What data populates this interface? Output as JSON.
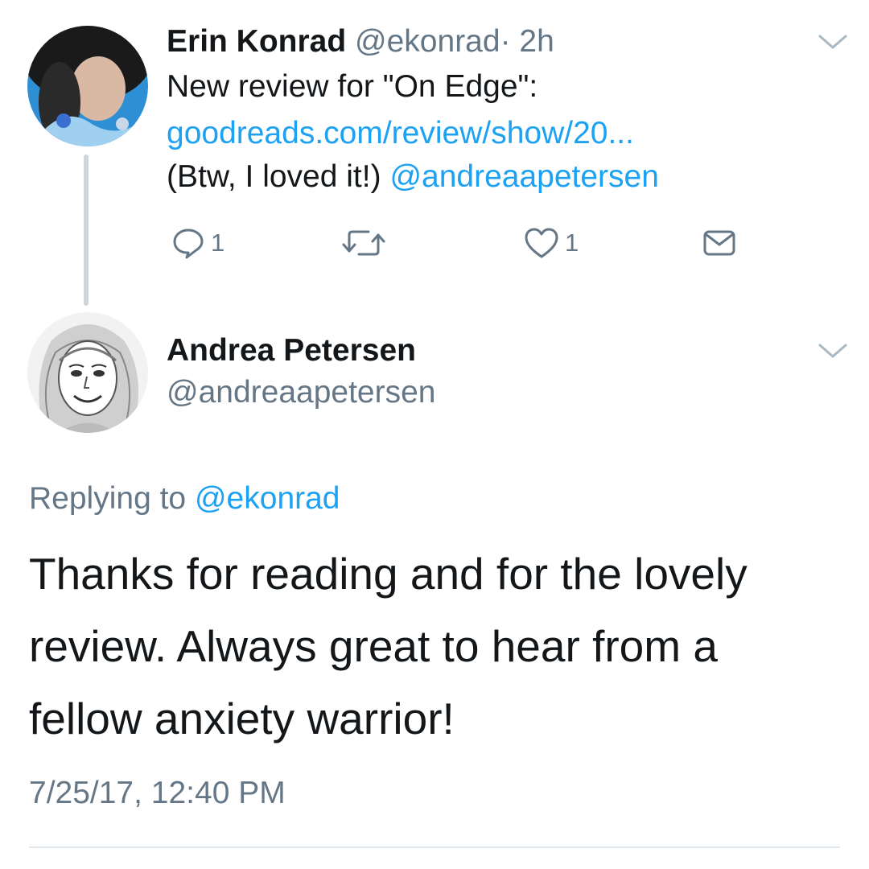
{
  "parent_tweet": {
    "author_name": "Erin Konrad",
    "author_handle": "@ekonrad",
    "separator": "·",
    "time": "2h",
    "text_line1": "New review for \"On Edge\":",
    "link": "goodreads.com/review/show/20...",
    "text_line3": "(Btw, I loved it!)",
    "mention": "@andreaapetersen",
    "actions": {
      "reply_count": "1",
      "retweet_count": "",
      "like_count": "1"
    },
    "icons": [
      "reply-icon",
      "retweet-icon",
      "like-icon",
      "message-icon",
      "chevron-down-icon"
    ]
  },
  "reply_tweet": {
    "author_name": "Andrea Petersen",
    "author_handle": "@andreaapetersen",
    "replying_prefix": "Replying to",
    "replying_handle": "@ekonrad",
    "text": "Thanks for reading and for the lovely review. Always great to hear from a fellow anxiety warrior!",
    "timestamp": "7/25/17, 12:40 PM"
  },
  "colors": {
    "link": "#1da1f2",
    "secondary_text": "#657786",
    "primary_text": "#14171a",
    "thread_line": "#cdd6dd"
  }
}
